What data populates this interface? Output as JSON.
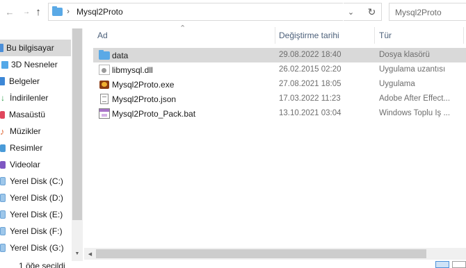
{
  "address_bar": {
    "back_icon": "back-arrow-icon",
    "forward_icon": "forward-arrow-icon",
    "recent_icon": "chevron-down-icon",
    "up_icon": "up-arrow-icon",
    "folder_icon": "folder-icon",
    "separator": "›",
    "path": "Mysql2Proto",
    "dropdown_glyph": "⌄",
    "refresh_glyph": "↻"
  },
  "search": {
    "text": "Mysql2Proto"
  },
  "nav_pane": {
    "items": [
      {
        "label": "Bu bilgisayar",
        "icon": "this-pc-icon",
        "selected": true
      },
      {
        "label": "3D Nesneler",
        "icon": "3d-objects-icon"
      },
      {
        "label": "Belgeler",
        "icon": "documents-icon"
      },
      {
        "label": "İndirilenler",
        "icon": "downloads-icon"
      },
      {
        "label": "Masaüstü",
        "icon": "desktop-icon"
      },
      {
        "label": "Müzikler",
        "icon": "music-icon"
      },
      {
        "label": "Resimler",
        "icon": "pictures-icon"
      },
      {
        "label": "Videolar",
        "icon": "videos-icon"
      },
      {
        "label": "Yerel Disk (C:)",
        "icon": "drive-icon"
      },
      {
        "label": "Yerel Disk (D:)",
        "icon": "drive-icon"
      },
      {
        "label": "Yerel Disk (E:)",
        "icon": "drive-icon"
      },
      {
        "label": "Yerel Disk (F:)",
        "icon": "drive-icon"
      },
      {
        "label": "Yerel Disk (G:)",
        "icon": "drive-icon"
      }
    ]
  },
  "columns": {
    "name": "Ad",
    "date": "Değiştirme tarihi",
    "type": "Tür",
    "sort_glyph": "⌃"
  },
  "files": [
    {
      "name": "data",
      "date": "29.08.2022 18:40",
      "type": "Dosya klasörü",
      "icon": "folder-icon",
      "selected": true
    },
    {
      "name": "libmysql.dll",
      "date": "26.02.2015 02:20",
      "type": "Uygulama uzantısı",
      "icon": "dll-file-icon"
    },
    {
      "name": "Mysql2Proto.exe",
      "date": "27.08.2021 18:05",
      "type": "Uygulama",
      "icon": "exe-file-icon"
    },
    {
      "name": "Mysql2Proto.json",
      "date": "17.03.2022 11:23",
      "type": "Adobe After Effect...",
      "icon": "json-file-icon"
    },
    {
      "name": "Mysql2Proto_Pack.bat",
      "date": "13.10.2021 03:04",
      "type": "Windows Toplu İş ...",
      "icon": "bat-file-icon"
    }
  ],
  "status_bar": {
    "text": "1 öğe seçildi"
  }
}
